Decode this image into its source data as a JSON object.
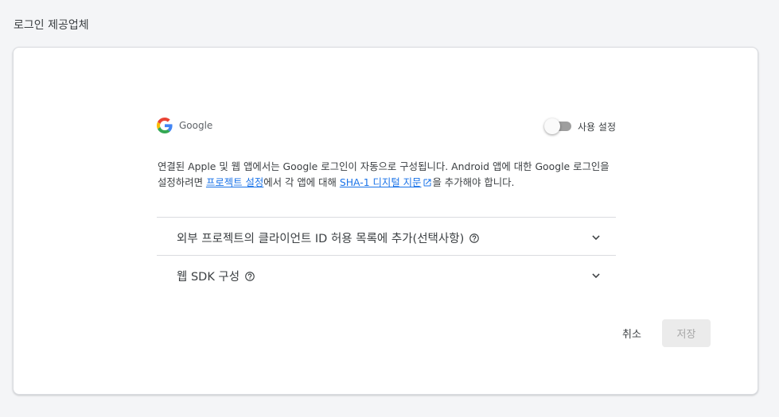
{
  "page": {
    "section_title": "로그인 제공업체"
  },
  "provider": {
    "name": "Google",
    "toggle_label": "사용 설정",
    "enabled": false
  },
  "description": {
    "part1": "연결된 Apple 및 웹 앱에서는 Google 로그인이 자동으로 구성됩니다. Android 앱에 대한 Google 로그인을 설정하려면 ",
    "link1": "프로젝트 설정",
    "part2": "에서 각 앱에 대해 ",
    "link2": "SHA-1 디지털 지문",
    "part3": "을 추가해야 합니다."
  },
  "expanders": [
    {
      "title": "외부 프로젝트의 클라이언트 ID 허용 목록에 추가(선택사항)"
    },
    {
      "title": "웹 SDK 구성"
    }
  ],
  "actions": {
    "cancel_label": "취소",
    "save_label": "저장"
  },
  "colors": {
    "link": "#1a73e8",
    "toggle_off_track": "#9e9e9e",
    "save_disabled_bg": "#ebebeb"
  },
  "icons": {
    "provider_logo": "google-logo-icon",
    "external_link": "external-link-icon",
    "help": "help-circle-icon",
    "expand": "chevron-down-icon"
  }
}
